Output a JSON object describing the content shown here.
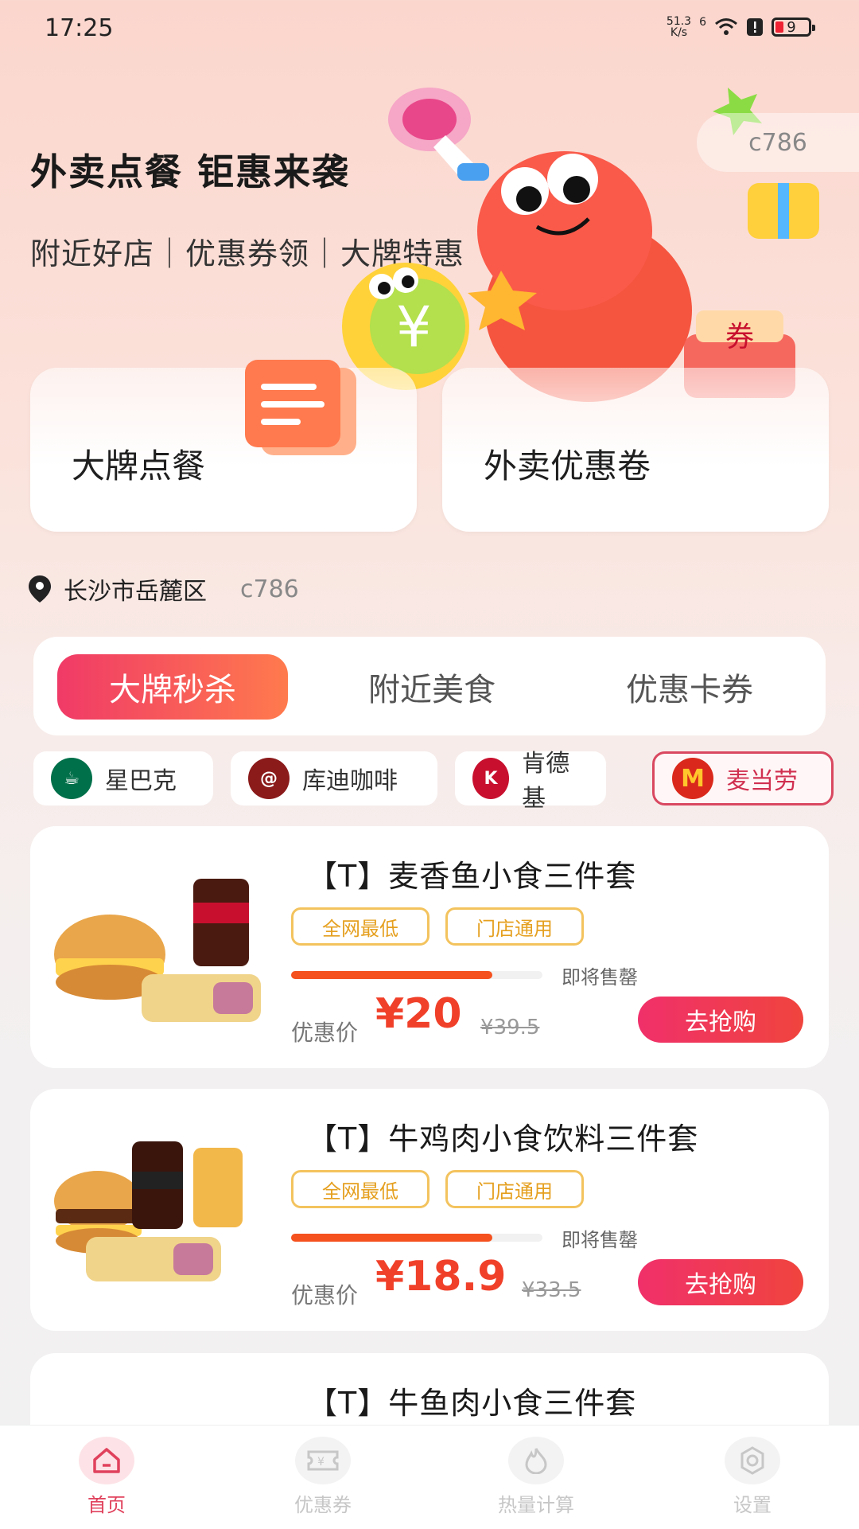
{
  "status_bar": {
    "time": "17:25",
    "net_speed_value": "51.3",
    "net_speed_unit": "K/s",
    "signal": "6",
    "battery": "9"
  },
  "hero": {
    "title": "外卖点餐 钜惠来袭",
    "subtitle": "附近好店｜优惠券领｜大牌特惠",
    "watermark": "c786"
  },
  "entries": [
    {
      "label": "大牌点餐"
    },
    {
      "label": "外卖优惠卷"
    }
  ],
  "location": {
    "city": "长沙市岳麓区",
    "code": "c786"
  },
  "tabs": [
    {
      "label": "大牌秒杀",
      "active": true
    },
    {
      "label": "附近美食",
      "active": false
    },
    {
      "label": "优惠卡券",
      "active": false
    }
  ],
  "brands": [
    {
      "name": "星巴克",
      "icon": "starbucks-logo",
      "color": "#00704a"
    },
    {
      "name": "库迪咖啡",
      "icon": "cotti-logo",
      "color": "#8b1a1a"
    },
    {
      "name": "肯德基",
      "icon": "kfc-logo",
      "color": "#c8102e"
    },
    {
      "name": "麦当劳",
      "icon": "mcdonalds-logo",
      "color": "#da291c",
      "active": true
    }
  ],
  "products": [
    {
      "title": "【T】麦香鱼小食三件套",
      "tags": [
        "全网最低",
        "门店通用"
      ],
      "progress": 0.8,
      "soon": "即将售罄",
      "price_label": "优惠价",
      "price": "¥20",
      "original": "¥39.5",
      "buy": "去抢购"
    },
    {
      "title": "【T】牛鸡肉小食饮料三件套",
      "tags": [
        "全网最低",
        "门店通用"
      ],
      "progress": 0.8,
      "soon": "即将售罄",
      "price_label": "优惠价",
      "price": "¥18.9",
      "original": "¥33.5",
      "buy": "去抢购"
    },
    {
      "title": "【T】牛鱼肉小食三件套"
    }
  ],
  "bottom_nav": [
    {
      "label": "首页",
      "icon": "home-icon",
      "active": true
    },
    {
      "label": "优惠券",
      "icon": "coupon-icon",
      "active": false
    },
    {
      "label": "热量计算",
      "icon": "flame-icon",
      "active": false
    },
    {
      "label": "设置",
      "icon": "settings-icon",
      "active": false
    }
  ],
  "colors": {
    "accent": "#f0306a",
    "price": "#f0402a",
    "tag": "#e5a020"
  }
}
